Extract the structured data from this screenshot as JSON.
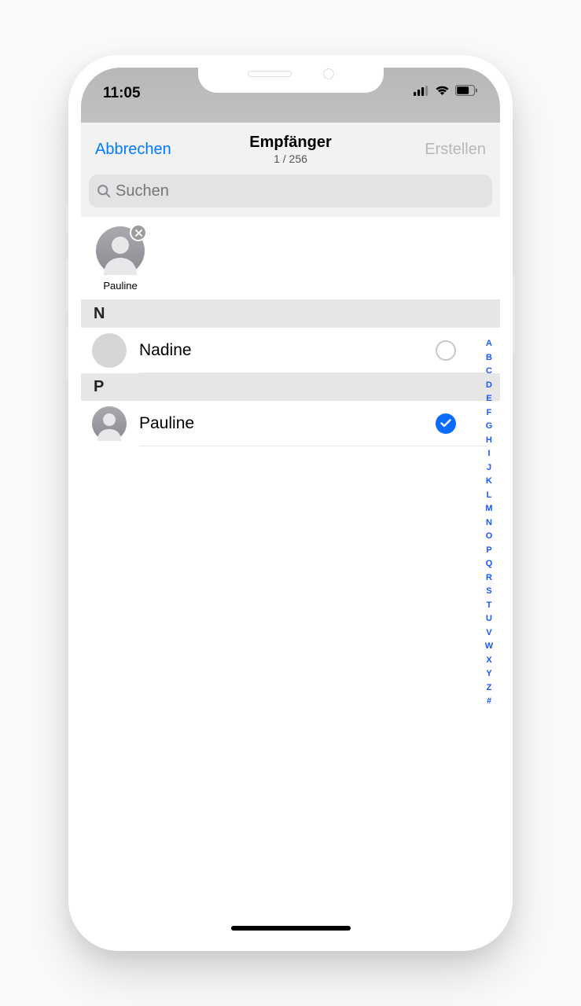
{
  "status": {
    "time": "11:05"
  },
  "nav": {
    "left": "Abbrechen",
    "title": "Empfänger",
    "subtitle": "1 / 256",
    "right": "Erstellen"
  },
  "search": {
    "placeholder": "Suchen"
  },
  "selected": [
    {
      "name": "Pauline"
    }
  ],
  "sections": [
    {
      "letter": "N",
      "items": [
        {
          "name": "Nadine",
          "selected": false,
          "avatar": "flat"
        }
      ]
    },
    {
      "letter": "P",
      "items": [
        {
          "name": "Pauline",
          "selected": true,
          "avatar": "grad"
        }
      ]
    }
  ],
  "index": [
    "A",
    "B",
    "C",
    "D",
    "E",
    "F",
    "G",
    "H",
    "I",
    "J",
    "K",
    "L",
    "M",
    "N",
    "O",
    "P",
    "Q",
    "R",
    "S",
    "T",
    "U",
    "V",
    "W",
    "X",
    "Y",
    "Z",
    "#"
  ]
}
